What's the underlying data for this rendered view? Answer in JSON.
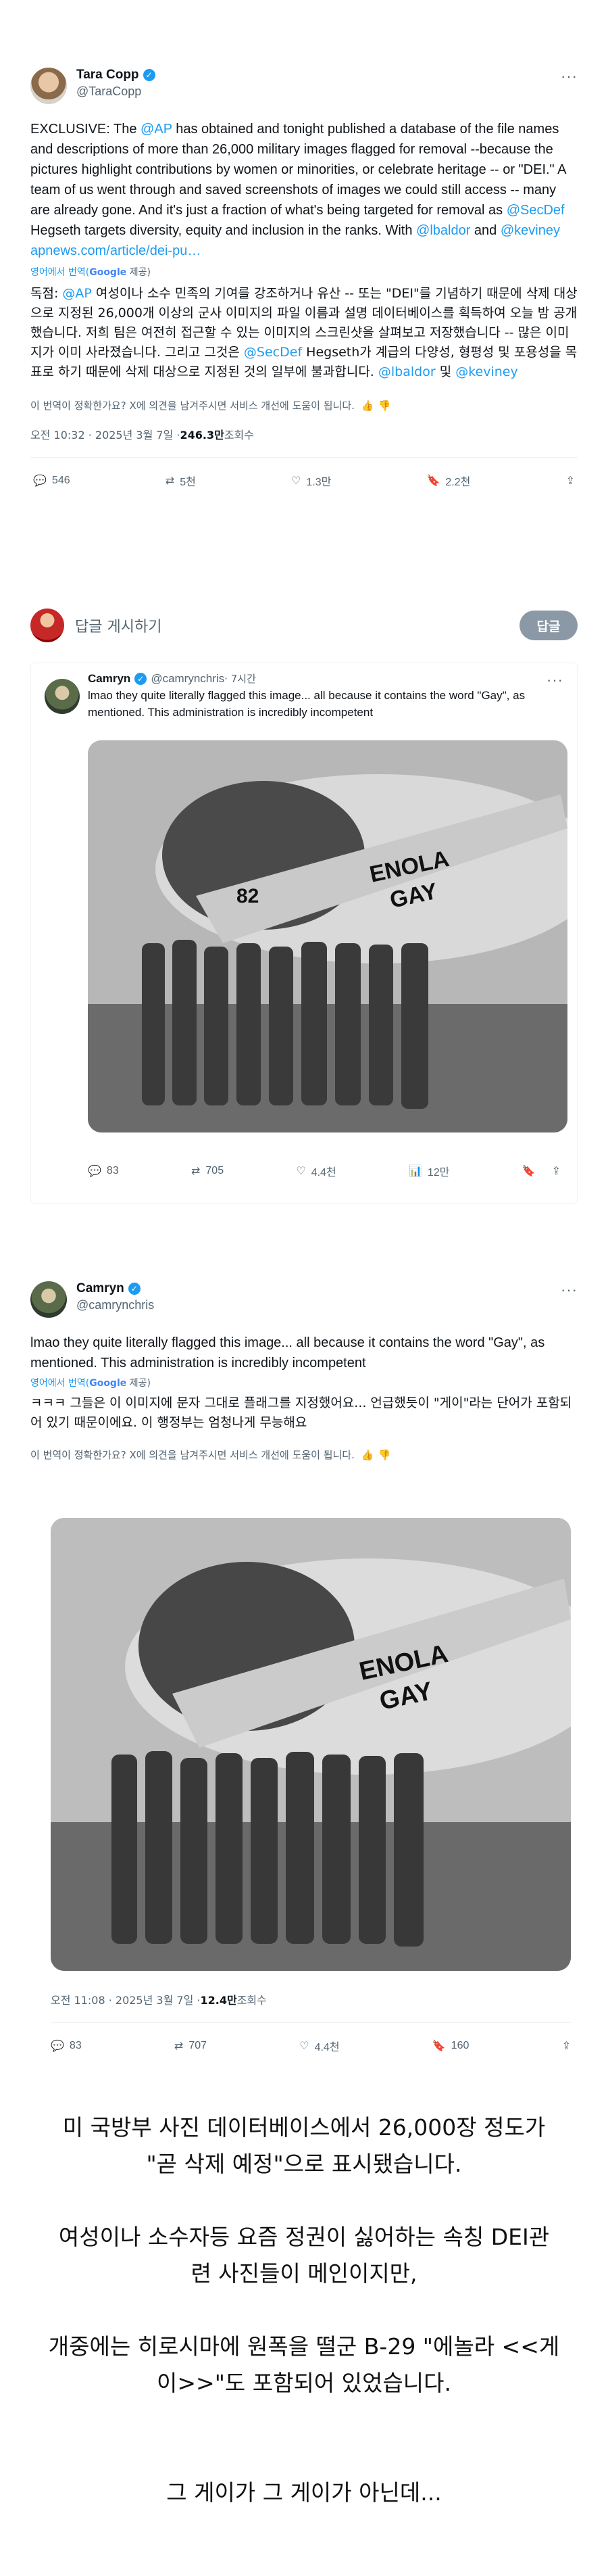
{
  "tweet1": {
    "author_name": "Tara Copp",
    "author_handle": "@TaraCopp",
    "more": "···",
    "body_p1": "EXCLUSIVE: The ",
    "mention_ap": "@AP",
    "body_p2": "  has obtained and tonight published a database of the file names and descriptions of more than 26,000 military images flagged for removal --because the pictures highlight contributions by women or minorities, or celebrate heritage -- or \"DEI.\" A team of us went through and saved screenshots of images we could still access -- many are already gone. And it's just a fraction of what's being targeted for removal as ",
    "mention_secdef": "@SecDef",
    "body_p3": " Hegseth targets diversity, equity and inclusion in the ranks. With ",
    "mention_lbaldor": "@lbaldor",
    "body_and": " and ",
    "mention_keviney": "@keviney",
    "link": " apnews.com/article/dei-pu…",
    "translated_from": "영어에서 번역(",
    "google": "Google",
    "provided": " 제공)",
    "kr_prefix": "독점: ",
    "kr_ap": "@AP",
    "kr_body1": " 여성이나 소수 민족의 기여를 강조하거나 유산 -- 또는 \"DEI\"를 기념하기 때문에 삭제 대상으로 지정된 26,000개 이상의 군사 이미지의 파일 이름과 설명 데이터베이스를 획득하여 오늘 밤 공개했습니다. 저희 팀은 여전히 접근할 수 있는 이미지의 스크린샷을 살펴보고 저장했습니다 -- 많은 이미지가 이미 사라졌습니다. 그리고 그것은 ",
    "kr_secdef": "@SecDef",
    "kr_body2": " Hegseth가 계급의 다양성, 형평성 및 포용성을 목표로 하기 때문에 삭제 대상으로 지정된 것의 일부에 불과합니다. ",
    "kr_lbaldor": "@lbaldor",
    "kr_and": " 및 ",
    "kr_keviney": "@keviney",
    "feedback": "이 번역이 정확한가요? X에 의견을 남겨주시면 서비스 개선에 도움이 됩니다.",
    "time": "오전 10:32 · 2025년 3월 7일 · ",
    "views": "246.3만",
    "views_label": " 조회수",
    "replies": "546",
    "retweets": "5천",
    "likes": "1.3만",
    "bookmarks": "2.2천"
  },
  "reply_box": {
    "placeholder": "답글 게시하기",
    "button": "답글"
  },
  "reply": {
    "author_name": "Camryn",
    "author_handle": "@camrynchris",
    "time": " · 7시간",
    "more": "···",
    "text": "lmao they quite literally flagged this image... all because it contains the word \"Gay\", as mentioned. This administration is incredibly incompetent",
    "replies": "83",
    "retweets": "705",
    "likes": "4.4천",
    "views": "12만"
  },
  "tweet2": {
    "author_name": "Camryn",
    "author_handle": "@camrynchris",
    "more": "···",
    "text": "lmao they quite literally flagged this image... all because it contains the word \"Gay\", as mentioned. This administration is incredibly incompetent",
    "translated_from": "영어에서 번역(",
    "google": "Google",
    "provided": " 제공)",
    "kr_text": "ㅋㅋㅋ 그들은 이 이미지에 문자 그대로 플래그를 지정했어요... 언급했듯이 \"게이\"라는 단어가 포함되어 있기 때문이에요. 이 행정부는 엄청나게 무능해요",
    "feedback": "이 번역이 정확한가요? X에 의견을 남겨주시면 서비스 개선에 도움이 됩니다.",
    "time": "오전 11:08 · 2025년 3월 7일 · ",
    "views": "12.4만",
    "views_label": " 조회수",
    "replies": "83",
    "retweets": "707",
    "likes": "4.4천",
    "bookmarks": "160"
  },
  "plane_label_1": "ENOLA",
  "plane_label_2": "GAY",
  "plane_number": "82",
  "caption": {
    "line1": "미 국방부 사진 데이터베이스에서 26,000장 정도가",
    "line2": "\"곧 삭제 예정\"으로 표시됐습니다.",
    "line3": "여성이나 소수자등 요즘 정권이 싫어하는 속칭 DEI관",
    "line4": "련 사진들이 메인이지만,",
    "line5": "개중에는 히로시마에 원폭을 떨군 B-29 \"에놀라 <<게",
    "line6": "이>>\"도 포함되어 있었습니다.",
    "line7": "그 게이가 그 게이가 아닌데..."
  },
  "colors": {
    "accent": "#1d9bf0",
    "muted": "#536471",
    "button": "#8b98a5"
  }
}
